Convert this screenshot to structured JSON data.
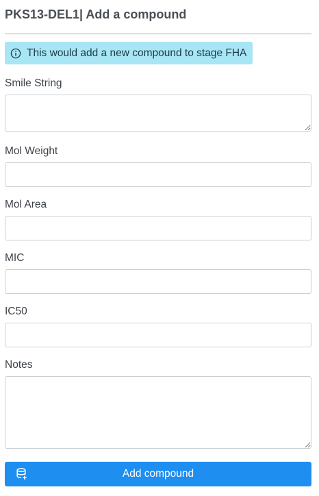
{
  "header": {
    "title": "PKS13-DEL1| Add a compound"
  },
  "alert": {
    "icon": "info-circle-icon",
    "text": "This would add a new compound to stage FHA",
    "background": "#a8e5f5"
  },
  "form": {
    "smile_string": {
      "label": "Smile String",
      "value": ""
    },
    "mol_weight": {
      "label": "Mol Weight",
      "value": ""
    },
    "mol_area": {
      "label": "Mol Area",
      "value": ""
    },
    "mic": {
      "label": "MIC",
      "value": ""
    },
    "ic50": {
      "label": "IC50",
      "value": ""
    },
    "notes": {
      "label": "Notes",
      "value": ""
    }
  },
  "submit": {
    "label": "Add compound",
    "icon": "database-add-icon",
    "color": "#1e8ef0"
  }
}
